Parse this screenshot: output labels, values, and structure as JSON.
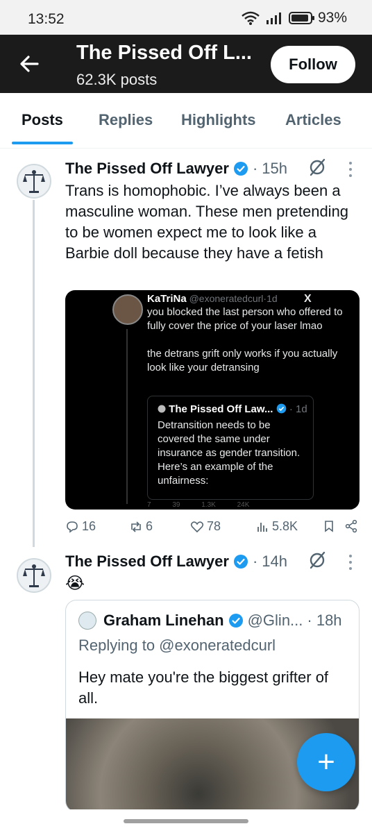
{
  "status_bar": {
    "time": "13:52",
    "battery_percent": "93%",
    "battery_level": 0.93
  },
  "header": {
    "title": "The Pissed Off L...",
    "post_count": "62.3K posts",
    "follow_label": "Follow"
  },
  "tabs": [
    {
      "label": "Posts",
      "active": true
    },
    {
      "label": "Replies",
      "active": false
    },
    {
      "label": "Highlights",
      "active": false
    },
    {
      "label": "Articles",
      "active": false
    }
  ],
  "tweets": [
    {
      "author": "The Pissed Off Lawyer",
      "separator": "·",
      "time": "15h",
      "text": "Trans is homophobic. I’ve always been a masculine woman. These men pretending to be women expect me to look like a Barbie doll because they have a fetish",
      "embedded_screenshot": {
        "name": "KaTriNa",
        "handle": "@exoneratedcurl·1d",
        "x_mark": "X",
        "text_1": "you blocked the last person who offered to fully cover the price of your laser lmao",
        "text_2": "the detrans grift only works if you actually look like your detransing",
        "quoted_name": "The Pissed Off Law...",
        "quoted_time": "· 1d",
        "quoted_text": "Detransition needs to be covered the same under insurance as gender transition. Here’s an example of the unfairness:",
        "action_counts": "7 39 1.3K 24K"
      },
      "stats": {
        "replies": "16",
        "reposts": "6",
        "likes": "78",
        "views": "5.8K"
      }
    },
    {
      "author": "The Pissed Off Lawyer",
      "separator": "·",
      "time": "14h",
      "text": "😭",
      "quote": {
        "name": "Graham Linehan",
        "handle": "@Glin...",
        "time": "· 18h",
        "replying_to": "Replying to @exoneratedcurl",
        "text": "Hey mate you're the biggest grifter of all."
      }
    }
  ],
  "fab_label": "+",
  "colors": {
    "accent": "#1d9bf0",
    "header_bg": "#1b1b1b",
    "secondary_text": "#536471"
  },
  "icons": {
    "back": "arrow-left-icon",
    "verified": "verified-badge-icon",
    "grok": "grok-icon",
    "more": "more-vertical-icon",
    "reply": "reply-icon",
    "repost": "repost-icon",
    "like": "heart-icon",
    "views": "views-icon",
    "bookmark": "bookmark-icon",
    "share": "share-icon",
    "wifi": "wifi-icon",
    "signal": "signal-icon",
    "battery": "battery-icon"
  }
}
